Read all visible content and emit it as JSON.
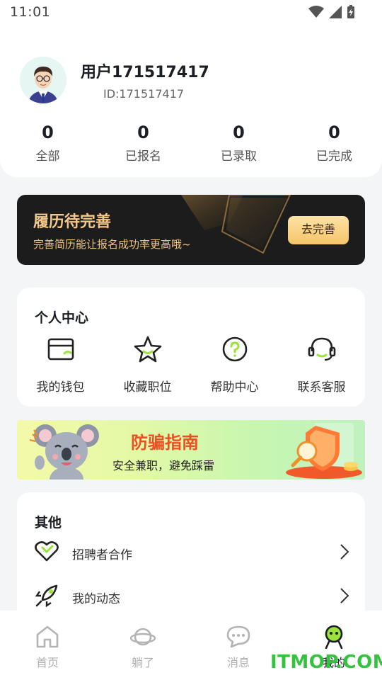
{
  "status_bar": {
    "time": "11:01"
  },
  "profile": {
    "username": "用户171517417",
    "user_id": "ID:171517417",
    "stats": [
      {
        "value": "0",
        "label": "全部"
      },
      {
        "value": "0",
        "label": "已报名"
      },
      {
        "value": "0",
        "label": "已录取"
      },
      {
        "value": "0",
        "label": "已完成"
      }
    ]
  },
  "resume_banner": {
    "title": "履历待完善",
    "subtitle": "完善简历能让报名成功率更高哦~",
    "button": "去完善"
  },
  "personal_center": {
    "title": "个人中心",
    "items": [
      {
        "label": "我的钱包",
        "icon": "wallet-icon"
      },
      {
        "label": "收藏职位",
        "icon": "star-icon"
      },
      {
        "label": "帮助中心",
        "icon": "help-icon"
      },
      {
        "label": "联系客服",
        "icon": "headset-icon"
      }
    ]
  },
  "fraud_banner": {
    "title": "防骗指南",
    "subtitle": "安全兼职，避免踩雷"
  },
  "other": {
    "title": "其他",
    "items": [
      {
        "label": "招聘者合作",
        "icon": "handshake-icon"
      },
      {
        "label": "我的动态",
        "icon": "rocket-icon"
      }
    ]
  },
  "tabbar": {
    "items": [
      {
        "label": "首页",
        "icon": "home-icon"
      },
      {
        "label": "躺了",
        "icon": "planet-icon"
      },
      {
        "label": "消息",
        "icon": "chat-icon"
      },
      {
        "label": "我的",
        "icon": "profile-icon"
      }
    ],
    "active": "我的"
  },
  "watermark": "ITMOP.COM",
  "colors": {
    "accent_gold": "#f2c98a",
    "fraud_red": "#f04d23",
    "active_green": "#9be23c",
    "watermark_green": "#35c23f"
  }
}
